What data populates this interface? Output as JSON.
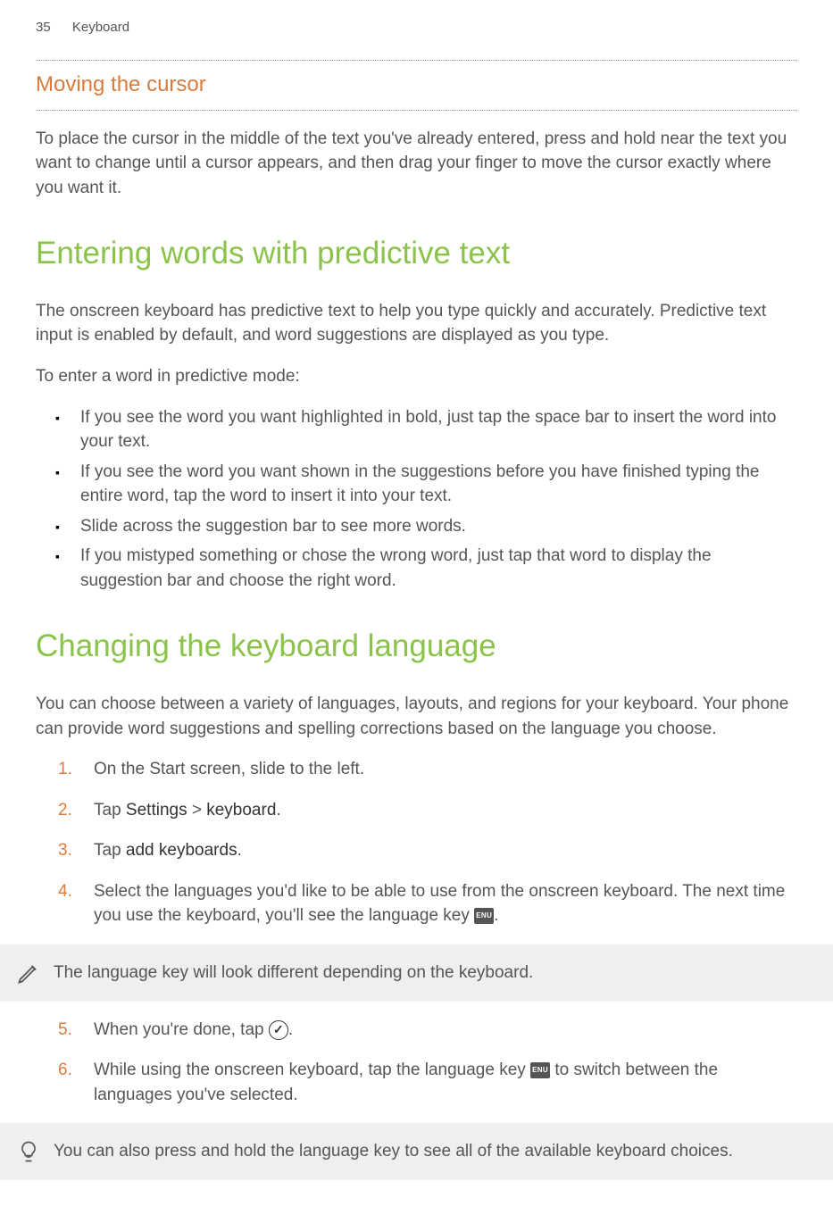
{
  "header": {
    "page_number": "35",
    "section": "Keyboard"
  },
  "section1": {
    "title": "Moving the cursor",
    "body": "To place the cursor in the middle of the text you've already entered, press and hold near the text you want to change until a cursor appears, and then drag your finger to move the cursor exactly where you want it."
  },
  "section2": {
    "title": "Entering words with predictive text",
    "intro": "The onscreen keyboard has predictive text to help you type quickly and accurately. Predictive text input is enabled by default, and word suggestions are displayed as you type.",
    "lead": "To enter a word in predictive mode:",
    "bullets": [
      "If you see the word you want highlighted in bold, just tap the space bar to insert the word into your text.",
      "If you see the word you want shown in the suggestions before you have finished typing the entire word, tap the word to insert it into your text.",
      "Slide across the suggestion bar to see more words.",
      "If you mistyped something or chose the wrong word, just tap that word to display the suggestion bar and choose the right word."
    ]
  },
  "section3": {
    "title": "Changing the keyboard language",
    "intro": "You can choose between a variety of languages, layouts, and regions for your keyboard. Your phone can provide word suggestions and spelling corrections based on the language you choose.",
    "steps": {
      "s1": "On the Start screen, slide to the left.",
      "s2_pre": "Tap ",
      "s2_strong1": "Settings",
      "s2_mid": " > ",
      "s2_strong2": "keyboard",
      "s2_post": ".",
      "s3_pre": "Tap ",
      "s3_strong": "add keyboards",
      "s3_post": ".",
      "s4_a": "Select the languages you'd like to be able to use from the onscreen keyboard. The next time you use the keyboard, you'll see the language key ",
      "s4_b": ".",
      "s5_a": "When you're done, tap ",
      "s5_b": ".",
      "s6_a": "While using the onscreen keyboard, tap the language key ",
      "s6_b": " to switch between the languages you've selected."
    },
    "note1": "The language key will look different depending on the keyboard.",
    "note2": "You can also press and hold the language key to see all of the available keyboard choices.",
    "icon_label": "ENU"
  },
  "numbers": {
    "n1": "1.",
    "n2": "2.",
    "n3": "3.",
    "n4": "4.",
    "n5": "5.",
    "n6": "6."
  }
}
